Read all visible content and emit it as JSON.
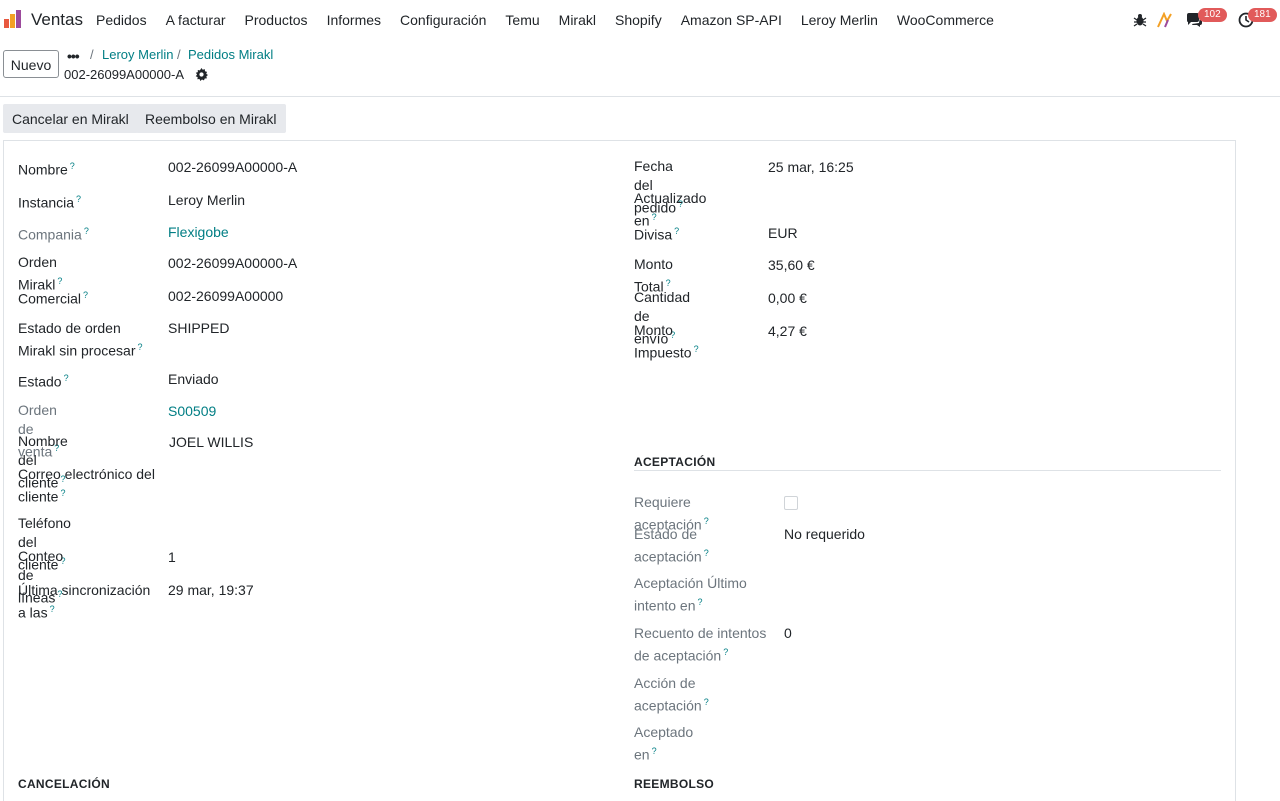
{
  "app": {
    "name": "Ventas"
  },
  "menu": [
    "Pedidos",
    "A facturar",
    "Productos",
    "Informes",
    "Configuración",
    "Temu",
    "Mirakl",
    "Shopify",
    "Amazon SP-API",
    "Leroy Merlin",
    "WooCommerce"
  ],
  "systray": {
    "messages_count": "102",
    "activities_count": "181"
  },
  "control": {
    "new_label": "Nuevo",
    "breadcrumb": [
      "Leroy Merlin",
      "Pedidos Mirakl"
    ],
    "record_title": "002-26099A00000-A"
  },
  "actions": {
    "cancel_label": "Cancelar en Mirakl",
    "refund_label": "Reembolso en Mirakl"
  },
  "left_fields": [
    {
      "label": "Nombre",
      "value": "002-26099A00000-A"
    },
    {
      "label": "Instancia",
      "value": "Leroy Merlin"
    },
    {
      "label": "Compania",
      "value": "Flexigobe"
    },
    {
      "label": "Orden Mirakl",
      "value": "002-26099A00000-A"
    },
    {
      "label": "Comercial",
      "value": "002-26099A00000"
    },
    {
      "label_line1": "Estado de orden",
      "label_line2": "Mirakl sin procesar",
      "value": "SHIPPED"
    },
    {
      "label": "Estado",
      "value": "Enviado"
    },
    {
      "label": "Orden de venta",
      "value": "S00509"
    },
    {
      "label": "Nombre del cliente",
      "value": "JOEL WILLIS"
    },
    {
      "label_line1": "Correo electrónico del",
      "label_line2": "cliente",
      "value": ""
    },
    {
      "label": "Teléfono del cliente",
      "value": ""
    },
    {
      "label": "Conteo de líneas",
      "value": "1"
    },
    {
      "label_line1": "Última sincronización",
      "label_line2": "a las",
      "value": "29 mar, 19:37"
    }
  ],
  "right_fields": [
    {
      "label": "Fecha del pedido",
      "value": "25 mar, 16:25"
    },
    {
      "label": "Actualizado en",
      "value": ""
    },
    {
      "label": "Divisa",
      "value": "EUR"
    },
    {
      "label": "Monto Total",
      "value": "35,60 €"
    },
    {
      "label": "Cantidad de envío",
      "value": "0,00 €"
    },
    {
      "label": "Monto Impuesto",
      "value": "4,27 €"
    }
  ],
  "acceptance": {
    "title": "ACEPTACIÓN",
    "fields": [
      {
        "label": "Requiere aceptación",
        "value": ""
      },
      {
        "label_line1": "Estado de",
        "label_line2": "aceptación",
        "value": "No requerido"
      },
      {
        "label_line1": "Aceptación Último",
        "label_line2": "intento en",
        "value": ""
      },
      {
        "label_line1": "Recuento de intentos",
        "label_line2": "de aceptación",
        "value": "0"
      },
      {
        "label_line1": "Acción de",
        "label_line2": "aceptación",
        "value": ""
      },
      {
        "label": "Aceptado en",
        "value": ""
      }
    ]
  },
  "sections": {
    "cancel_title": "CANCELACIÓN",
    "refund_title": "REEMBOLSO"
  },
  "help_mark": "?"
}
